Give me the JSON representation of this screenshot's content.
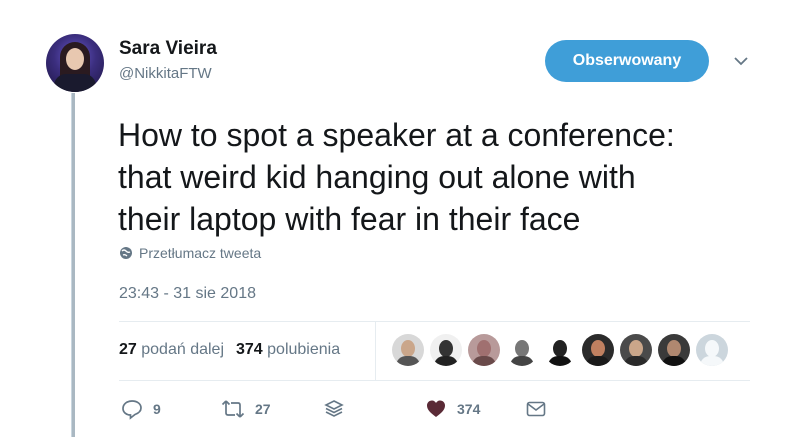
{
  "user": {
    "name": "Sara Vieira",
    "handle": "@NikkitaFTW"
  },
  "follow_button": {
    "label": "Obserwowany",
    "color": "#3f9ed8"
  },
  "tweet": {
    "lines": [
      "How to spot a speaker at a conference:",
      "that weird kid hanging out alone with",
      "their laptop with fear in their face"
    ],
    "translate_label": "Przetłumacz tweeta",
    "timestamp": "23:43 - 31 sie 2018"
  },
  "stats": {
    "retweets_count": "27",
    "retweets_label": "podań dalej",
    "likes_count": "374",
    "likes_label": "polubienia"
  },
  "likers": [
    {
      "name": "liker-1"
    },
    {
      "name": "liker-2"
    },
    {
      "name": "liker-3"
    },
    {
      "name": "liker-4"
    },
    {
      "name": "liker-5"
    },
    {
      "name": "liker-6"
    },
    {
      "name": "liker-7"
    },
    {
      "name": "liker-8"
    },
    {
      "name": "liker-9"
    }
  ],
  "actions": {
    "reply_count": "9",
    "retweet_count": "27",
    "like_count": "374"
  },
  "icons": {
    "reply": "reply-icon",
    "retweet": "retweet-icon",
    "stack": "stack-icon",
    "like": "heart-icon",
    "message": "envelope-icon",
    "globe": "globe-icon",
    "chevron": "chevron-down-icon"
  },
  "colors": {
    "text": "#14171a",
    "muted": "#657786",
    "like_heart": "#5a2a36"
  }
}
